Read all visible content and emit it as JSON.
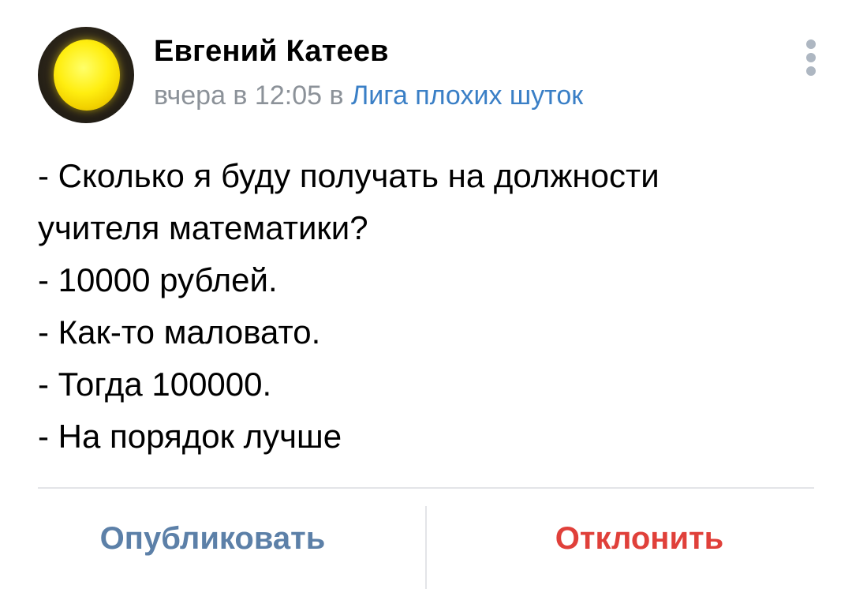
{
  "post": {
    "author": "Евгений Катеев",
    "meta": {
      "time_prefix": "вчера в 12:05 в",
      "group": "Лига плохих шуток",
      "secondary_color": "#8c9299",
      "link_color": "#3a7fc6"
    },
    "icons": {
      "avatar": "avatar-yellow-lamp",
      "menu": "more-vertical-icon"
    },
    "text_lines": [
      "- Сколько я буду получать на должности",
      "учителя математики?",
      "- 10000 рублей.",
      "- Как-то маловато.",
      "- Тогда 100000.",
      "- На порядок лучше"
    ]
  },
  "actions": {
    "publish_label": "Опубликовать",
    "reject_label": "Отклонить",
    "publish_color": "#5c80a8",
    "reject_color": "#e0403a"
  }
}
